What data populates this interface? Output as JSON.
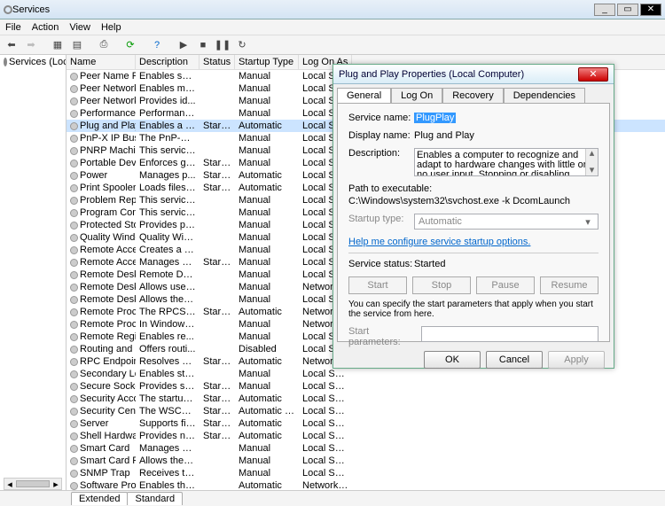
{
  "window": {
    "title": "Services",
    "min": "_",
    "max": "▭",
    "close": "✕"
  },
  "menu": [
    "File",
    "Action",
    "View",
    "Help"
  ],
  "left": {
    "item": "Services (Loca"
  },
  "columns": [
    "Name",
    "Description",
    "Status",
    "Startup Type",
    "Log On As"
  ],
  "services": [
    {
      "n": "Peer Name Re...",
      "d": "Enables ser...",
      "s": "",
      "t": "Manual",
      "l": "Local Servi..."
    },
    {
      "n": "Peer Network...",
      "d": "Enables mul...",
      "s": "",
      "t": "Manual",
      "l": "Local Servi..."
    },
    {
      "n": "Peer Network...",
      "d": "Provides id...",
      "s": "",
      "t": "Manual",
      "l": "Local Servi..."
    },
    {
      "n": "Performance L...",
      "d": "Performance...",
      "s": "",
      "t": "Manual",
      "l": "Local Servi..."
    },
    {
      "n": "Plug and Play",
      "d": "Enables a c...",
      "s": "Started",
      "t": "Automatic",
      "l": "Local Syst...",
      "sel": true
    },
    {
      "n": "PnP-X IP Bus E...",
      "d": "The PnP-X b...",
      "s": "",
      "t": "Manual",
      "l": "Local Syst..."
    },
    {
      "n": "PNRP Machine...",
      "d": "This service ...",
      "s": "",
      "t": "Manual",
      "l": "Local Servi..."
    },
    {
      "n": "Portable Devic...",
      "d": "Enforces gr...",
      "s": "Started",
      "t": "Manual",
      "l": "Local Syst..."
    },
    {
      "n": "Power",
      "d": "Manages p...",
      "s": "Started",
      "t": "Automatic",
      "l": "Local Syst..."
    },
    {
      "n": "Print Spooler",
      "d": "Loads files t...",
      "s": "Started",
      "t": "Automatic",
      "l": "Local Syst..."
    },
    {
      "n": "Problem Repo...",
      "d": "This service ...",
      "s": "",
      "t": "Manual",
      "l": "Local Syst..."
    },
    {
      "n": "Program Com...",
      "d": "This service ...",
      "s": "",
      "t": "Manual",
      "l": "Local Syst..."
    },
    {
      "n": "Protected Stor...",
      "d": "Provides pr...",
      "s": "",
      "t": "Manual",
      "l": "Local Syst..."
    },
    {
      "n": "Quality Windo...",
      "d": "Quality Win...",
      "s": "",
      "t": "Manual",
      "l": "Local Servi..."
    },
    {
      "n": "Remote Acces...",
      "d": "Creates a c...",
      "s": "",
      "t": "Manual",
      "l": "Local Syst..."
    },
    {
      "n": "Remote Acces...",
      "d": "Manages di...",
      "s": "Started",
      "t": "Manual",
      "l": "Local Syst..."
    },
    {
      "n": "Remote Deskt...",
      "d": "Remote Des...",
      "s": "",
      "t": "Manual",
      "l": "Local Syst..."
    },
    {
      "n": "Remote Deskt...",
      "d": "Allows user...",
      "s": "",
      "t": "Manual",
      "l": "Network S..."
    },
    {
      "n": "Remote Deskt...",
      "d": "Allows the r...",
      "s": "",
      "t": "Manual",
      "l": "Local Syst..."
    },
    {
      "n": "Remote Proce...",
      "d": "The RPCSS s...",
      "s": "Started",
      "t": "Automatic",
      "l": "Network S..."
    },
    {
      "n": "Remote Proce...",
      "d": "In Windows...",
      "s": "",
      "t": "Manual",
      "l": "Network S..."
    },
    {
      "n": "Remote Regist...",
      "d": "Enables re...",
      "s": "",
      "t": "Manual",
      "l": "Local Servi..."
    },
    {
      "n": "Routing and R...",
      "d": "Offers routi...",
      "s": "",
      "t": "Disabled",
      "l": "Local Syst..."
    },
    {
      "n": "RPC Endpoint ...",
      "d": "Resolves RP...",
      "s": "Started",
      "t": "Automatic",
      "l": "Network S..."
    },
    {
      "n": "Secondary Lo...",
      "d": "Enables star...",
      "s": "",
      "t": "Manual",
      "l": "Local Syst..."
    },
    {
      "n": "Secure Socket ...",
      "d": "Provides su...",
      "s": "Started",
      "t": "Manual",
      "l": "Local Servi..."
    },
    {
      "n": "Security Accou...",
      "d": "The startup ...",
      "s": "Started",
      "t": "Automatic",
      "l": "Local Syst..."
    },
    {
      "n": "Security Center",
      "d": "The WSCSV...",
      "s": "Started",
      "t": "Automatic (...",
      "l": "Local Servi..."
    },
    {
      "n": "Server",
      "d": "Supports fil...",
      "s": "Started",
      "t": "Automatic",
      "l": "Local Syst..."
    },
    {
      "n": "Shell Hardwar...",
      "d": "Provides no...",
      "s": "Started",
      "t": "Automatic",
      "l": "Local Syst..."
    },
    {
      "n": "Smart Card",
      "d": "Manages ac...",
      "s": "",
      "t": "Manual",
      "l": "Local Servi..."
    },
    {
      "n": "Smart Card Re...",
      "d": "Allows the s...",
      "s": "",
      "t": "Manual",
      "l": "Local Syst..."
    },
    {
      "n": "SNMP Trap",
      "d": "Receives tra...",
      "s": "",
      "t": "Manual",
      "l": "Local Servi..."
    },
    {
      "n": "Software Prot...",
      "d": "Enables the ...",
      "s": "",
      "t": "Automatic",
      "l": "Network S..."
    }
  ],
  "bottomTabs": [
    "Extended",
    "Standard"
  ],
  "dlg": {
    "title": "Plug and Play Properties (Local Computer)",
    "tabs": [
      "General",
      "Log On",
      "Recovery",
      "Dependencies"
    ],
    "serviceNameLabel": "Service name:",
    "serviceName": "PlugPlay",
    "displayNameLabel": "Display name:",
    "displayName": "Plug and Play",
    "descriptionLabel": "Description:",
    "description": "Enables a computer to recognize and adapt to hardware changes with little or no user input. Stopping or disabling",
    "pathLabel": "Path to executable:",
    "path": "C:\\Windows\\system32\\svchost.exe -k DcomLaunch",
    "startupLabel": "Startup type:",
    "startupValue": "Automatic",
    "helpLink": "Help me configure service startup options.",
    "statusLabel": "Service status:",
    "statusValue": "Started",
    "btnStart": "Start",
    "btnStop": "Stop",
    "btnPause": "Pause",
    "btnResume": "Resume",
    "specify": "You can specify the start parameters that apply when you start the service from here.",
    "startParamsLabel": "Start parameters:",
    "ok": "OK",
    "cancel": "Cancel",
    "apply": "Apply"
  }
}
